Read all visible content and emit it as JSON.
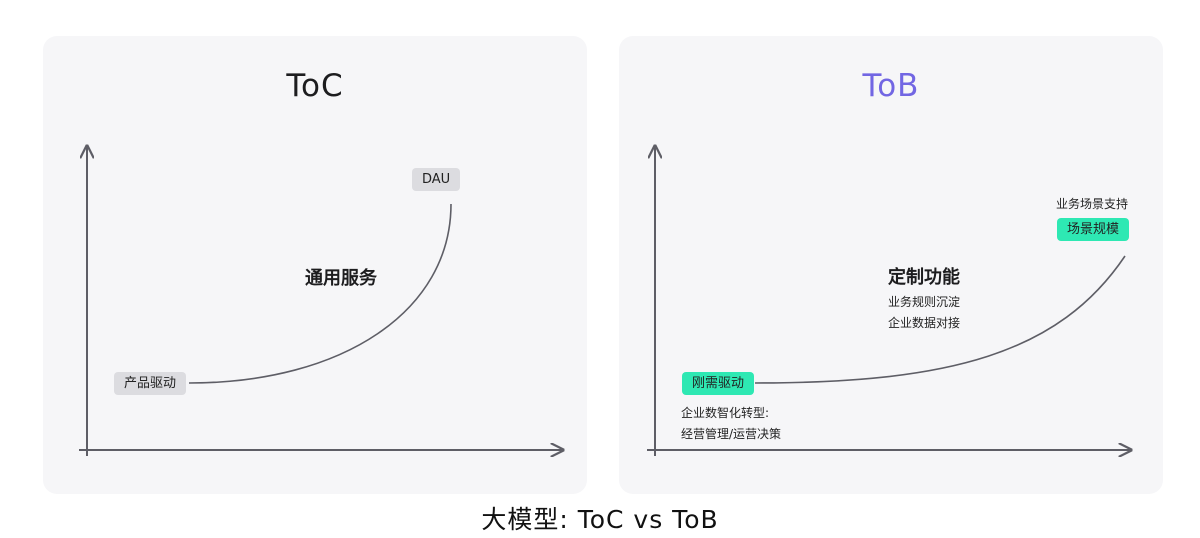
{
  "left": {
    "title": "ToC",
    "start_tag": "产品驱动",
    "end_tag": "DAU",
    "curve_label": "通用服务"
  },
  "right": {
    "title": "ToB",
    "start_tag": "刚需驱动",
    "start_note": [
      "企业数智化转型:",
      "经营管理/运营决策"
    ],
    "end_tag": "场景规模",
    "end_note": "业务场景支持",
    "curve_label": "定制功能",
    "curve_note": [
      "业务规则沉淀",
      "企业数据对接"
    ]
  },
  "caption": "大模型: ToC vs ToB",
  "colors": {
    "axis": "#5e5e66",
    "tob_title": "#7266e3",
    "green_tag": "#2ee8b3",
    "gray_tag": "#dcdce0"
  }
}
